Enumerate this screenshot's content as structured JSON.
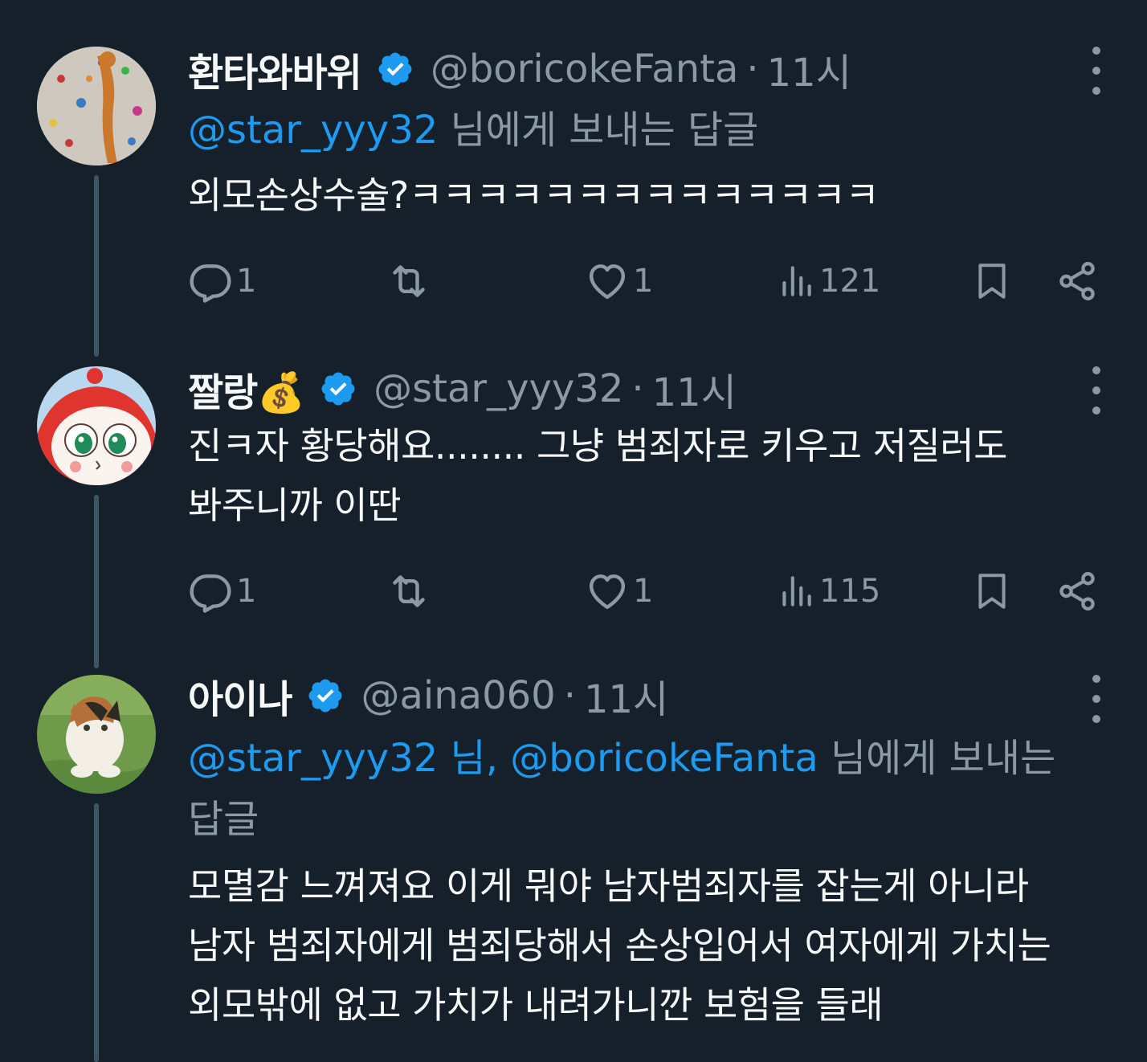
{
  "tweets": [
    {
      "name": "환타와바위",
      "handle": "@boricokeFanta",
      "separator": "·",
      "time": "11시",
      "reply_mentions": "@star_yyy32",
      "reply_suffix": " 님에게 보내는 답글",
      "text": "외모손상수술?ㅋㅋㅋㅋㅋㅋㅋㅋㅋㅋㅋㅋㅋㅋ",
      "replies": "1",
      "likes": "1",
      "views": "121"
    },
    {
      "name": "짤랑💰",
      "handle": "@star_yyy32",
      "separator": "·",
      "time": "11시",
      "text_line1": "진ㅋ자 황당해요........ 그냥 범죄자로 키우고 저질러도",
      "text_line2": "봐주니까 이딴",
      "replies": "1",
      "likes": "1",
      "views": "115"
    },
    {
      "name": "아이나",
      "handle": "@aina060",
      "separator": "·",
      "time": "11시",
      "reply_mentions": "@star_yyy32 님, @boricokeFanta",
      "reply_suffix": " 님에게 보내는",
      "reply_line2": "답글",
      "text_line1": "모멸감 느껴져요 이게 뭐야 남자범죄자를 잡는게 아니라",
      "text_line2": "남자 범죄자에게 범죄당해서 손상입어서 여자에게 가치는",
      "text_line3": "외모밖에 없고 가치가 내려가니깐 보험을 들래"
    }
  ],
  "icons": {
    "verified": "verified-badge-icon",
    "reply": "reply-icon",
    "retweet": "retweet-icon",
    "like": "heart-icon",
    "views": "views-icon",
    "bookmark": "bookmark-icon",
    "share": "share-icon",
    "more": "more-icon"
  },
  "colors": {
    "background": "#15202b",
    "text": "#f7f9f9",
    "secondary": "#8b98a5",
    "accent": "#1d9bf0",
    "thread_line": "#3d5466"
  }
}
